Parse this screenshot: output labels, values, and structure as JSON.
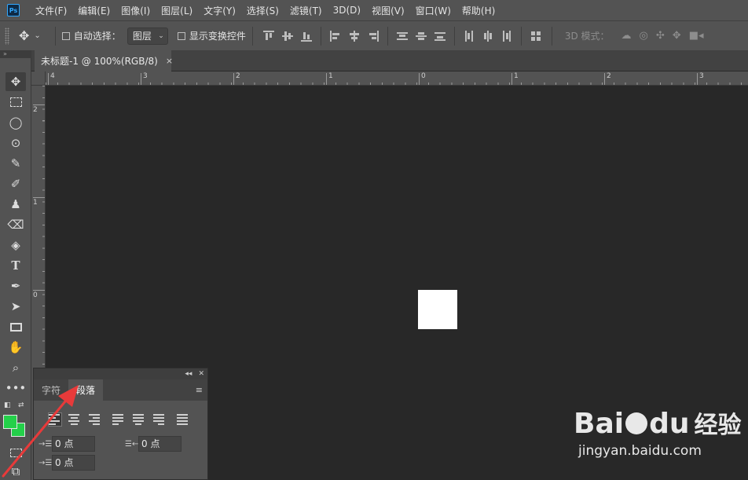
{
  "app": {
    "logo": "Ps"
  },
  "menu": [
    "文件(F)",
    "编辑(E)",
    "图像(I)",
    "图层(L)",
    "文字(Y)",
    "选择(S)",
    "滤镜(T)",
    "3D(D)",
    "视图(V)",
    "窗口(W)",
    "帮助(H)"
  ],
  "options": {
    "auto_select_label": "自动选择：",
    "auto_select_target": "图层",
    "show_transform_label": "显示变换控件",
    "mode_3d_label": "3D 模式："
  },
  "document": {
    "tab_title": "未标题-1 @ 100%(RGB/8)",
    "close_glyph": "×"
  },
  "rulers": {
    "horizontal_labels": [
      "4",
      "3",
      "2",
      "1",
      "0",
      "1",
      "2",
      "3"
    ],
    "vertical_labels": [
      "2",
      "1",
      "0"
    ]
  },
  "canvas": {
    "background_color": "#282828",
    "shape_color": "#ffffff"
  },
  "colors": {
    "foreground": "#24d04a",
    "background": "#24d04a",
    "arrow": "#e83a3a"
  },
  "tools": [
    "move-icon",
    "marquee-icon",
    "lasso-icon",
    "quick-select-icon",
    "eyedropper-icon",
    "brush-icon",
    "stamp-icon",
    "eraser-icon",
    "fill-icon",
    "type-icon",
    "pen-icon",
    "path-select-icon",
    "rectangle-icon",
    "hand-icon",
    "zoom-icon",
    "more-icon"
  ],
  "panel": {
    "tabs": [
      "字符",
      "段落"
    ],
    "active_tab": "段落",
    "indent_left_value": "0 点",
    "indent_right_value": "0 点",
    "indent_first_value": "0 点"
  },
  "watermark": {
    "brand": "Bai",
    "brand_suffix": "du",
    "cn": "经验",
    "url": "jingyan.baidu.com"
  }
}
